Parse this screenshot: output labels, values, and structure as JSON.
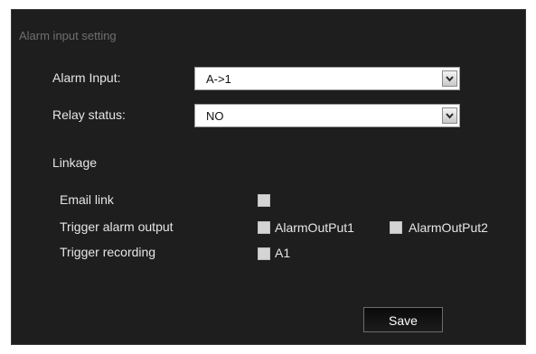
{
  "section_title": "Alarm input setting",
  "alarm_input": {
    "label": "Alarm Input:",
    "value": "A->1"
  },
  "relay_status": {
    "label": "Relay status:",
    "value": "NO"
  },
  "linkage": {
    "label": "Linkage",
    "email_link": {
      "label": "Email link",
      "checked": false
    },
    "trigger_alarm_output": {
      "label": "Trigger alarm output",
      "options": [
        {
          "label": "AlarmOutPut1",
          "checked": false
        },
        {
          "label": "AlarmOutPut2",
          "checked": false
        }
      ]
    },
    "trigger_recording": {
      "label": "Trigger recording",
      "options": [
        {
          "label": "A1",
          "checked": false
        }
      ]
    }
  },
  "save_label": "Save",
  "icons": {
    "dropdown": "chevron-down-icon"
  },
  "colors": {
    "panel_background": "#1e1e1e",
    "text": "#e6e6e6",
    "section_title": "#6f6f6f"
  }
}
